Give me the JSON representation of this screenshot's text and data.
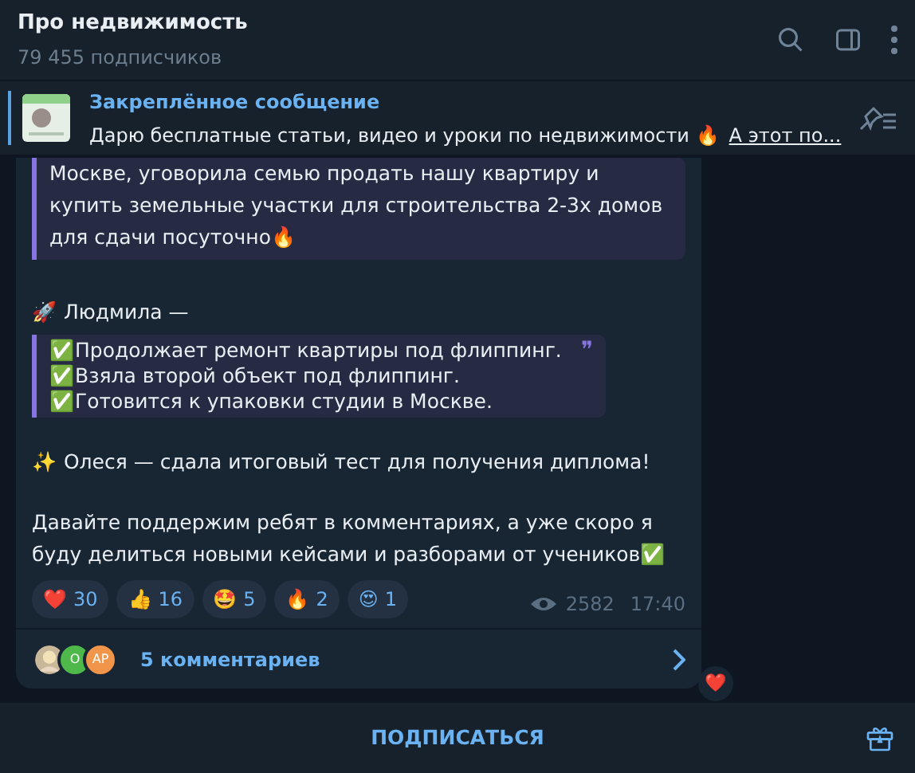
{
  "header": {
    "title": "Про недвижимость",
    "subtitle": "79 455 подписчиков"
  },
  "pinned": {
    "label": "Закреплённое сообщение",
    "text": "Дарю бесплатные статьи, видео и уроки по недвижимости 🔥",
    "link": "А этот по..."
  },
  "message": {
    "quote_1": "Москве, уговорила семью продать нашу квартиру и купить земельные участки для строительства 2-3х домов для сдачи посуточно🔥",
    "author": "🚀 Людмила —",
    "quote_2": [
      "✅Продолжает ремонт квартиры под флиппинг.",
      "✅Взяла второй объект под флиппинг.",
      "✅Готовится к упаковки студии в Москве."
    ],
    "quote_mark": "❞",
    "paragraphs": [
      "✨ Олеся — сдала итоговый тест для получения диплома!",
      "Давайте поддержим ребят в комментариях, а уже скоро я буду делиться новыми кейсами и разборами от учеников✅"
    ],
    "reactions": [
      {
        "emoji": "❤️",
        "count": "30"
      },
      {
        "emoji": "👍",
        "count": "16"
      },
      {
        "emoji": "🤩",
        "count": "5"
      },
      {
        "emoji": "🔥",
        "count": "2"
      },
      {
        "emoji": "😍",
        "count": "1"
      }
    ],
    "views": "2582",
    "time": "17:40"
  },
  "comments": {
    "avatars": [
      {
        "kind": "picture"
      },
      {
        "kind": "initials",
        "label": "О",
        "color": "#4fb84a"
      },
      {
        "kind": "initials",
        "label": "АР",
        "color": "#f0954a"
      }
    ],
    "text": "5 комментариев"
  },
  "side_reaction": "❤️",
  "footer": {
    "button": "ПОДПИСАТЬСЯ"
  }
}
